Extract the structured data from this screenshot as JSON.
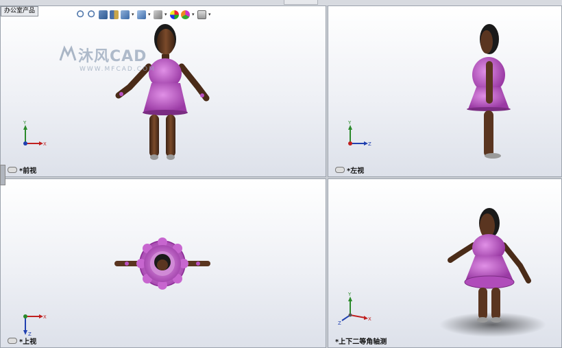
{
  "breadcrumb": "办公室产品",
  "watermark": {
    "brand": "沐风CAD",
    "url": "WWW.MFCAD.COM"
  },
  "viewports": {
    "front": {
      "label": "*前视"
    },
    "left": {
      "label": "*左视"
    },
    "top": {
      "label": "*上视"
    },
    "iso": {
      "label": "*上下二等角轴测"
    }
  },
  "triad": {
    "x": "X",
    "y": "Y",
    "z": "Z"
  },
  "colors": {
    "dress": "#b84fc0",
    "skin": "#5a3520",
    "hair": "#1a1a1a",
    "shoe": "#9a9a9a"
  },
  "toolbar_icons": [
    "zoom-fit-icon",
    "zoom-area-icon",
    "previous-view-icon",
    "section-view-icon",
    "view-orientation-icon",
    "display-style-icon",
    "hide-show-icon",
    "appearance-icon",
    "scene-icon",
    "view-settings-icon"
  ]
}
